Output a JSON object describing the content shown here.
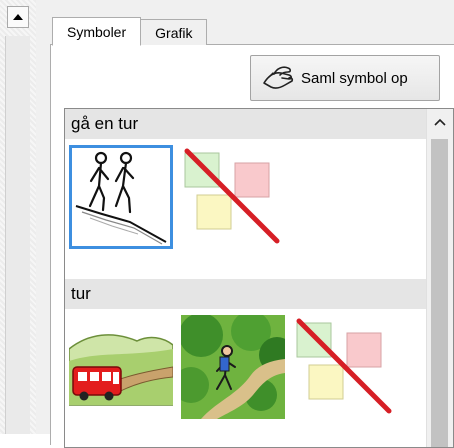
{
  "tabs": [
    {
      "label": "Symboler",
      "active": true
    },
    {
      "label": "Grafik",
      "active": false
    }
  ],
  "collect_button": {
    "label": "Saml symbol op",
    "icon": "hand-pickup-icon"
  },
  "sections": [
    {
      "header": "gå en tur",
      "symbols": [
        {
          "name": "two-people-walking-uphill",
          "selected": true
        },
        {
          "name": "no-symbol",
          "selected": false
        }
      ]
    },
    {
      "header": "tur",
      "symbols": [
        {
          "name": "bus-on-road-in-hills",
          "selected": false
        },
        {
          "name": "hiker-in-forest",
          "selected": false
        },
        {
          "name": "no-symbol",
          "selected": false
        }
      ]
    }
  ],
  "colors": {
    "selection": "#3d8fe0",
    "no_symbol_strike": "#d61f26",
    "section_header_bg": "#e5e5e5",
    "scroll_thumb": "#c2c2c2"
  }
}
